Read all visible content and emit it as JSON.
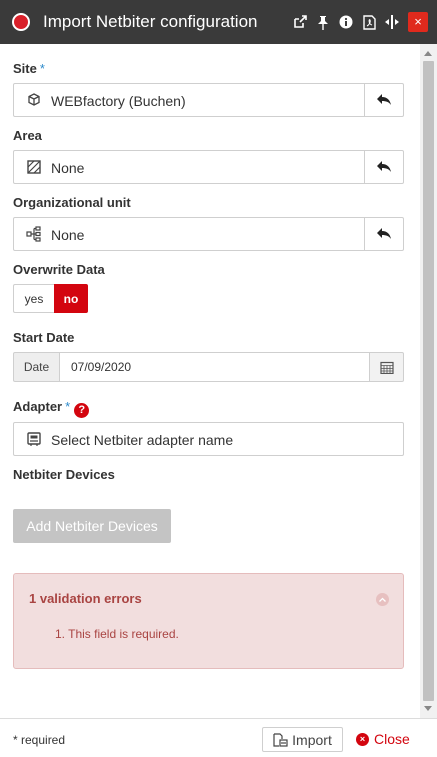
{
  "window": {
    "title": "Import Netbiter configuration",
    "status_color": "#d9202a",
    "toolbar_icons": [
      "external-link-icon",
      "pin-icon",
      "info-icon",
      "pdf-icon",
      "resize-icon",
      "close-icon"
    ],
    "close_glyph": "×"
  },
  "site": {
    "label": "Site",
    "required_mark": "*",
    "value": "WEBfactory (Buchen)",
    "icon": "cube-icon"
  },
  "area": {
    "label": "Area",
    "value": "None",
    "icon": "area-icon"
  },
  "org_unit": {
    "label": "Organizational unit",
    "value": "None",
    "icon": "sitemap-icon"
  },
  "overwrite": {
    "label": "Overwrite Data",
    "yes": "yes",
    "no": "no",
    "selected": "no",
    "active_color": "#d3050f"
  },
  "start_date": {
    "label": "Start Date",
    "addon": "Date",
    "value": "07/09/2020"
  },
  "adapter": {
    "label": "Adapter",
    "required_mark": "*",
    "help": "?",
    "placeholder": "Select Netbiter adapter name",
    "icon": "device-icon"
  },
  "devices": {
    "label": "Netbiter Devices",
    "add_button": "Add Netbiter Devices"
  },
  "validation": {
    "title": "1 validation errors",
    "items": [
      "1. This field is required."
    ],
    "color": "#a94442"
  },
  "footer": {
    "required_note": "* required",
    "import_label": "Import",
    "close_label": "Close"
  }
}
